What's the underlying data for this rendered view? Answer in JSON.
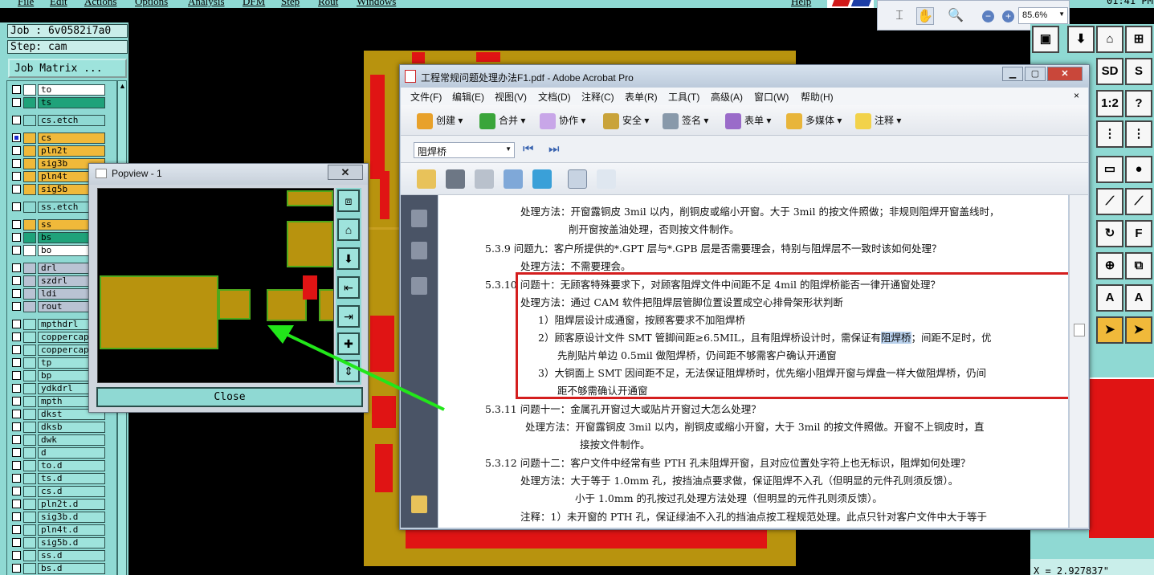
{
  "menubar": {
    "items": [
      "File",
      "Edit",
      "Actions",
      "Options",
      "Analysis",
      "DFM",
      "Step",
      "Rout",
      "Windows"
    ],
    "help": "Help",
    "clock": "01:41 PM"
  },
  "zoombar": {
    "zoom": "85.6%"
  },
  "job": {
    "job_label": "Job : 6v0582i7a0",
    "step_label": "Step: cam",
    "matrix_button": "Job Matrix ..."
  },
  "layers": [
    {
      "name": "to",
      "color": "#ffffff",
      "checked": false
    },
    {
      "name": "ts",
      "color": "#1fa27a",
      "checked": false
    },
    {
      "name": "cs.etch",
      "color": "#8fd9d3",
      "checked": false
    },
    {
      "name": "cs",
      "color": "#f0b93a",
      "checked": true
    },
    {
      "name": "pln2t",
      "color": "#f0b93a",
      "checked": false
    },
    {
      "name": "sig3b",
      "color": "#f0b93a",
      "checked": false
    },
    {
      "name": "pln4t",
      "color": "#f0b93a",
      "checked": false
    },
    {
      "name": "sig5b",
      "color": "#f0b93a",
      "checked": false
    },
    {
      "name": "ss.etch",
      "color": "#8fd9d3",
      "checked": false
    },
    {
      "name": "ss",
      "color": "#f0b93a",
      "checked": false
    },
    {
      "name": "bs",
      "color": "#1fa27a",
      "checked": false
    },
    {
      "name": "bo",
      "color": "#ffffff",
      "checked": false
    },
    {
      "name": "drl",
      "color": "#b9c3d3",
      "checked": false
    },
    {
      "name": "szdrl",
      "color": "#b9c3d3",
      "checked": false
    },
    {
      "name": "ldi",
      "color": "#b9c3d3",
      "checked": false
    },
    {
      "name": "rout",
      "color": "#b9c3d3",
      "checked": false
    },
    {
      "name": "mpthdrl",
      "color": "#9ee3dc",
      "checked": false
    },
    {
      "name": "coppercap",
      "color": "#9ee3dc",
      "checked": false
    },
    {
      "name": "coppercap",
      "color": "#9ee3dc",
      "checked": false
    },
    {
      "name": "tp",
      "color": "#9ee3dc",
      "checked": false
    },
    {
      "name": "bp",
      "color": "#9ee3dc",
      "checked": false
    },
    {
      "name": "ydkdrl",
      "color": "#9ee3dc",
      "checked": false
    },
    {
      "name": "mpth",
      "color": "#9ee3dc",
      "checked": false
    },
    {
      "name": "dkst",
      "color": "#9ee3dc",
      "checked": false
    },
    {
      "name": "dksb",
      "color": "#9ee3dc",
      "checked": false
    },
    {
      "name": "dwk",
      "color": "#9ee3dc",
      "checked": false
    },
    {
      "name": "d",
      "color": "#9ee3dc",
      "checked": false
    },
    {
      "name": "to.d",
      "color": "#9ee3dc",
      "checked": false
    },
    {
      "name": "ts.d",
      "color": "#9ee3dc",
      "checked": false
    },
    {
      "name": "cs.d",
      "color": "#9ee3dc",
      "checked": false
    },
    {
      "name": "pln2t.d",
      "color": "#9ee3dc",
      "checked": false
    },
    {
      "name": "sig3b.d",
      "color": "#9ee3dc",
      "checked": false
    },
    {
      "name": "pln4t.d",
      "color": "#9ee3dc",
      "checked": false
    },
    {
      "name": "sig5b.d",
      "color": "#9ee3dc",
      "checked": false
    },
    {
      "name": "ss.d",
      "color": "#9ee3dc",
      "checked": false
    },
    {
      "name": "bs.d",
      "color": "#9ee3dc",
      "checked": false
    }
  ],
  "popview": {
    "title": "Popview - 1",
    "close_label": "Close"
  },
  "coord": "X = 2.927837\"",
  "acrobat": {
    "title": "工程常规问题处理办法F1.pdf - Adobe Acrobat Pro",
    "menu": [
      "文件(F)",
      "编辑(E)",
      "视图(V)",
      "文档(D)",
      "注释(C)",
      "表单(R)",
      "工具(T)",
      "高级(A)",
      "窗口(W)",
      "帮助(H)"
    ],
    "menu_close": "×",
    "toolbar": [
      "创建",
      "合并",
      "协作",
      "安全",
      "签名",
      "表单",
      "多媒体",
      "注释"
    ],
    "search_value": "阻焊桥",
    "page_lines": [
      "处理方法：开窗露铜皮 3mil 以内，削铜皮或缩小开窗。大于 3mil 的按文件照做；非规则阻焊开窗盖线时，",
      "削开窗按盖油处理，否则按文件制作。",
      "5.3.9 问题九：客户所提供的*.GPT 层与*.GPB 层是否需要理会，特别与阻焊层不一致时该如何处理？",
      "处理方法：不需要理会。",
      "5.3.10 问题十：无顾客特殊要求下，对顾客阻焊文件中间距不足 4mil 的阻焊桥能否一律开通窗处理？",
      "处理方法：通过 CAM 软件把阻焊层管脚位置设置成空心排骨架形状判断",
      "1）阻焊层设计成通窗，按顾客要求不加阻焊桥",
      "2）顾客原设计文件 SMT 管脚间距≥6.5MIL，且有阻焊桥设计时，需保证有",
      "阻焊桥",
      "；间距不足时，优",
      "先削贴片单边 0.5mil 做阻焊桥，仍间距不够需客户确认开通窗",
      "3）大铜面上 SMT 因间距不足，无法保证阻焊桥时，优先缩小阻焊开窗与焊盘一样大做阻焊桥，仍间",
      "距不够需确认开通窗",
      "5.3.11 问题十一：金属孔开窗过大或贴片开窗过大怎么处理？",
      "处理方法：开窗露铜皮 3mil 以内，削铜皮或缩小开窗，大于 3mil 的按文件照做。开窗不上铜皮时，直",
      "接按文件制作。",
      "5.3.12 问题十二：客户文件中经常有些 PTH 孔未阻焊开窗，且对应位置处字符上也无标识，阻焊如何处理？",
      "处理方法：大于等于 1.0mm 孔，按挡油点要求做，保证阻焊不入孔（但明显的元件孔则须反馈）。",
      "小于 1.0mm 的孔按过孔处理方法处理（但明显的元件孔则须反馈）。",
      "注释：1）未开窗的 PTH 孔，保证绿油不入孔的挡油点按工程规范处理。此点只针对客户文件中大于等于"
    ]
  },
  "colors": {
    "arrow": "#22e61a",
    "highlight_box": "#d41e1e",
    "copper": "#b8930e",
    "panel": "#8fd9d3"
  }
}
